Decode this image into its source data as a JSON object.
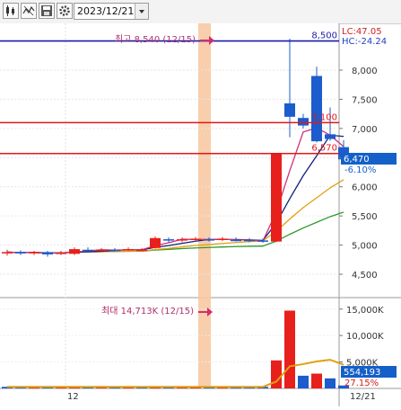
{
  "toolbar": {
    "date_value": "2023/12/21",
    "icons": [
      "candle-type-icon",
      "indicator-icon",
      "save-icon",
      "settings-icon"
    ]
  },
  "chart_data": {
    "type": "candlestick",
    "price_axis_ticks": [
      "8,000",
      "7,500",
      "7,000",
      "6,500",
      "6,000",
      "5,500",
      "5,000",
      "4,500"
    ],
    "volume_axis_ticks": [
      "15,000K",
      "10,000K",
      "5,000K"
    ],
    "x_axis_labels": [
      "12",
      "12/21"
    ],
    "price_range": [
      4200,
      8700
    ],
    "lines": [
      {
        "label": "8,500",
        "value": 8500,
        "color": "#1c1ca8"
      },
      {
        "label": "7,100",
        "value": 7100,
        "color": "#e01818"
      },
      {
        "label": "6,570",
        "value": 6570,
        "color": "#e01818"
      }
    ],
    "lc_label": "LC:47.05",
    "hc_label": "HC:-24.24",
    "current_price": "6,470",
    "current_change": "-6.10%",
    "current_volume": "554,193",
    "volume_ratio": "27.15%",
    "high_annotation": "최고 8,540 (12/15)",
    "volume_annotation": "최대 14,713K (12/15)",
    "candles": [
      {
        "o": 4870,
        "c": 4880,
        "h": 4920,
        "l": 4820
      },
      {
        "o": 4880,
        "c": 4860,
        "h": 4910,
        "l": 4830
      },
      {
        "o": 4860,
        "c": 4880,
        "h": 4900,
        "l": 4830
      },
      {
        "o": 4880,
        "c": 4840,
        "h": 4900,
        "l": 4800
      },
      {
        "o": 4860,
        "c": 4870,
        "h": 4900,
        "l": 4830
      },
      {
        "o": 4850,
        "c": 4930,
        "h": 4960,
        "l": 4830
      },
      {
        "o": 4920,
        "c": 4910,
        "h": 4960,
        "l": 4890
      },
      {
        "o": 4910,
        "c": 4920,
        "h": 4950,
        "l": 4890
      },
      {
        "o": 4920,
        "c": 4910,
        "h": 4950,
        "l": 4890
      },
      {
        "o": 4910,
        "c": 4930,
        "h": 4960,
        "l": 4900
      },
      {
        "o": 4920,
        "c": 4920,
        "h": 4950,
        "l": 4900
      },
      {
        "o": 4950,
        "c": 5120,
        "h": 5150,
        "l": 4940
      },
      {
        "o": 5100,
        "c": 5080,
        "h": 5130,
        "l": 5050
      },
      {
        "o": 5080,
        "c": 5100,
        "h": 5130,
        "l": 5050
      },
      {
        "o": 5090,
        "c": 5110,
        "h": 5140,
        "l": 5060
      },
      {
        "o": 5100,
        "c": 5080,
        "h": 5130,
        "l": 5060
      },
      {
        "o": 5090,
        "c": 5110,
        "h": 5140,
        "l": 5070
      },
      {
        "o": 5090,
        "c": 5080,
        "h": 5130,
        "l": 5060
      },
      {
        "o": 5090,
        "c": 5070,
        "h": 5120,
        "l": 5050
      },
      {
        "o": 5080,
        "c": 5060,
        "h": 5110,
        "l": 5040
      },
      {
        "o": 5060,
        "c": 6570,
        "h": 6570,
        "l": 5050
      },
      {
        "o": 7430,
        "c": 7200,
        "h": 8540,
        "l": 6850
      },
      {
        "o": 7180,
        "c": 7050,
        "h": 7250,
        "l": 7000
      },
      {
        "o": 7900,
        "c": 6780,
        "h": 8060,
        "l": 6760
      },
      {
        "o": 6900,
        "c": 6820,
        "h": 7360,
        "l": 6790
      },
      {
        "o": 6680,
        "c": 6470,
        "h": 6800,
        "l": 6420
      }
    ],
    "volumes": [
      {
        "v": 300,
        "up": false
      },
      {
        "v": 300,
        "up": false
      },
      {
        "v": 300,
        "up": true
      },
      {
        "v": 300,
        "up": false
      },
      {
        "v": 300,
        "up": true
      },
      {
        "v": 300,
        "up": true
      },
      {
        "v": 300,
        "up": false
      },
      {
        "v": 300,
        "up": true
      },
      {
        "v": 300,
        "up": false
      },
      {
        "v": 300,
        "up": true
      },
      {
        "v": 300,
        "up": false
      },
      {
        "v": 300,
        "up": true
      },
      {
        "v": 300,
        "up": false
      },
      {
        "v": 300,
        "up": true
      },
      {
        "v": 300,
        "up": true
      },
      {
        "v": 300,
        "up": false
      },
      {
        "v": 300,
        "up": true
      },
      {
        "v": 300,
        "up": false
      },
      {
        "v": 300,
        "up": false
      },
      {
        "v": 300,
        "up": false
      },
      {
        "v": 5300,
        "up": true
      },
      {
        "v": 14713,
        "up": true
      },
      {
        "v": 2400,
        "up": false
      },
      {
        "v": 2800,
        "up": true
      },
      {
        "v": 1900,
        "up": false
      },
      {
        "v": 554,
        "up": false
      }
    ],
    "volume_max": 17000
  }
}
